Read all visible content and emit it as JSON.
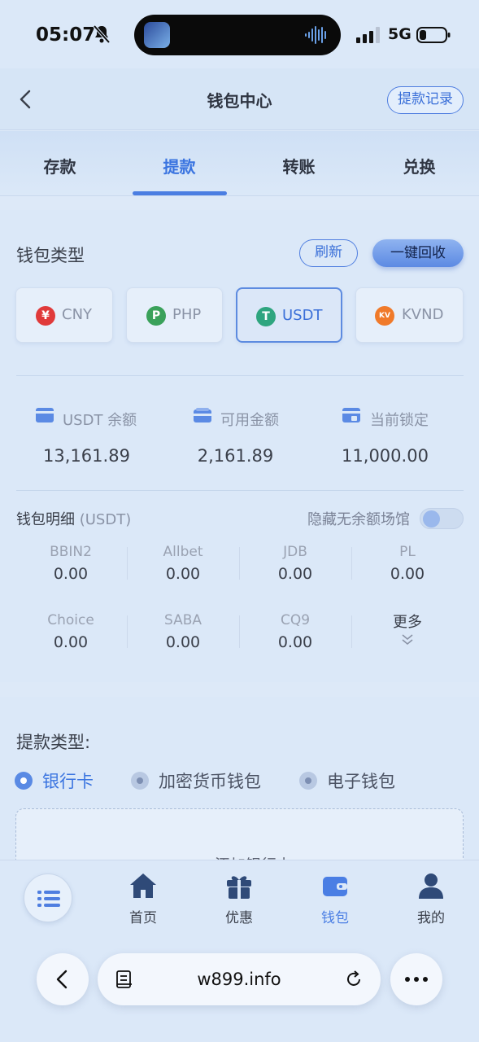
{
  "status_bar": {
    "time": "05:07",
    "network": "5G"
  },
  "header": {
    "title": "钱包中心",
    "record_button": "提款记录"
  },
  "tabs": [
    {
      "label": "存款"
    },
    {
      "label": "提款",
      "active": true
    },
    {
      "label": "转账"
    },
    {
      "label": "兑换"
    }
  ],
  "wallet": {
    "type_label": "钱包类型",
    "refresh_button": "刷新",
    "reclaim_button": "一键回收",
    "currencies": [
      {
        "code": "CNY",
        "symbol": "¥",
        "color": "#e03a3a"
      },
      {
        "code": "PHP",
        "symbol": "P",
        "color": "#3aa15a"
      },
      {
        "code": "USDT",
        "symbol": "T",
        "color": "#2ea57f",
        "selected": true
      },
      {
        "code": "KVND",
        "symbol": "KV",
        "color": "#f07a2a"
      }
    ],
    "balances": [
      {
        "title": "USDT 余额",
        "value": "13,161.89",
        "icon": "card-icon"
      },
      {
        "title": "可用金额",
        "value": "2,161.89",
        "icon": "wallet-card-icon"
      },
      {
        "title": "当前锁定",
        "value": "11,000.00",
        "icon": "locked-card-icon"
      }
    ],
    "detail_title": "钱包明细",
    "detail_unit": "(USDT)",
    "hide_empty_label": "隐藏无余额场馆",
    "hide_empty_enabled": false,
    "venues": [
      {
        "name": "BBIN2",
        "value": "0.00"
      },
      {
        "name": "Allbet",
        "value": "0.00"
      },
      {
        "name": "JDB",
        "value": "0.00"
      },
      {
        "name": "PL",
        "value": "0.00"
      },
      {
        "name": "Choice",
        "value": "0.00"
      },
      {
        "name": "SABA",
        "value": "0.00"
      },
      {
        "name": "CQ9",
        "value": "0.00"
      }
    ],
    "more_label": "更多"
  },
  "withdraw": {
    "type_title": "提款类型:",
    "options": [
      {
        "label": "银行卡",
        "selected": true
      },
      {
        "label": "加密货币钱包"
      },
      {
        "label": "电子钱包"
      }
    ],
    "add_card_label": "添加银行卡"
  },
  "bottom_nav": {
    "items": [
      {
        "label": "首页",
        "icon": "home-icon"
      },
      {
        "label": "优惠",
        "icon": "gift-icon"
      },
      {
        "label": "钱包",
        "icon": "wallet-icon",
        "active": true
      },
      {
        "label": "我的",
        "icon": "user-icon"
      }
    ]
  },
  "browser": {
    "url": "w899.info"
  },
  "colors": {
    "accent": "#4a7ee4",
    "background": "#dbe8f8"
  }
}
